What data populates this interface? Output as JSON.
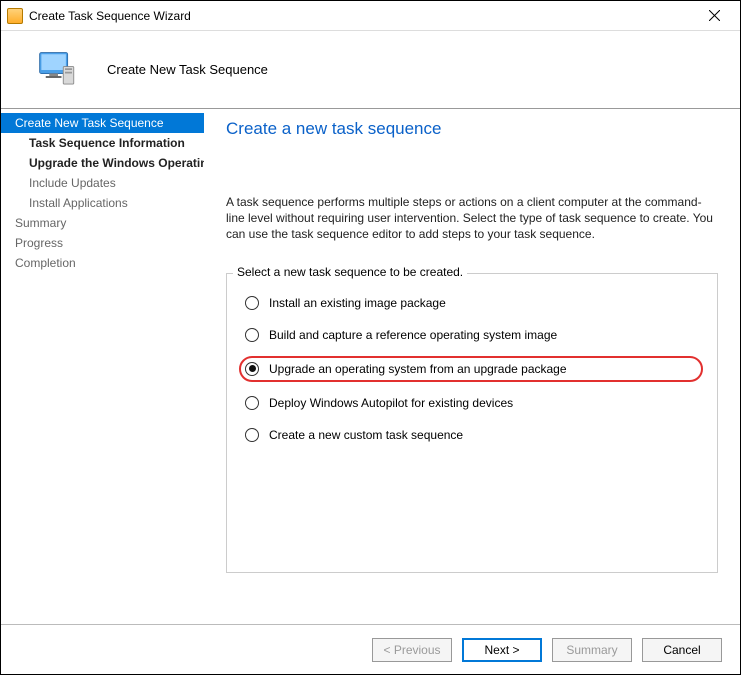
{
  "window": {
    "title": "Create Task Sequence Wizard"
  },
  "header": {
    "title": "Create New Task Sequence"
  },
  "sidebar": {
    "steps": [
      {
        "label": "Create New Task Sequence",
        "sub": false,
        "bold": false,
        "selected": true,
        "dim": false
      },
      {
        "label": "Task Sequence Information",
        "sub": true,
        "bold": true,
        "selected": false,
        "dim": false
      },
      {
        "label": "Upgrade the Windows Operating System",
        "sub": true,
        "bold": true,
        "selected": false,
        "dim": false
      },
      {
        "label": "Include Updates",
        "sub": true,
        "bold": false,
        "selected": false,
        "dim": true
      },
      {
        "label": "Install Applications",
        "sub": true,
        "bold": false,
        "selected": false,
        "dim": true
      },
      {
        "label": "Summary",
        "sub": false,
        "bold": false,
        "selected": false,
        "dim": true
      },
      {
        "label": "Progress",
        "sub": false,
        "bold": false,
        "selected": false,
        "dim": true
      },
      {
        "label": "Completion",
        "sub": false,
        "bold": false,
        "selected": false,
        "dim": true
      }
    ]
  },
  "main": {
    "heading": "Create a new task sequence",
    "description": "A task sequence performs multiple steps or actions on a client computer at the command-line level without requiring user intervention. Select the type of task sequence to create. You can use the task sequence editor to add steps to your task sequence.",
    "fieldset_legend": "Select a new task sequence to be created.",
    "options": [
      {
        "label": "Install an existing image package",
        "selected": false,
        "highlight": false
      },
      {
        "label": "Build and capture a reference operating system image",
        "selected": false,
        "highlight": false
      },
      {
        "label": "Upgrade an operating system from an upgrade package",
        "selected": true,
        "highlight": true
      },
      {
        "label": "Deploy Windows Autopilot for existing devices",
        "selected": false,
        "highlight": false
      },
      {
        "label": "Create a new custom task sequence",
        "selected": false,
        "highlight": false
      }
    ]
  },
  "footer": {
    "previous": "< Previous",
    "next": "Next >",
    "summary": "Summary",
    "cancel": "Cancel"
  }
}
